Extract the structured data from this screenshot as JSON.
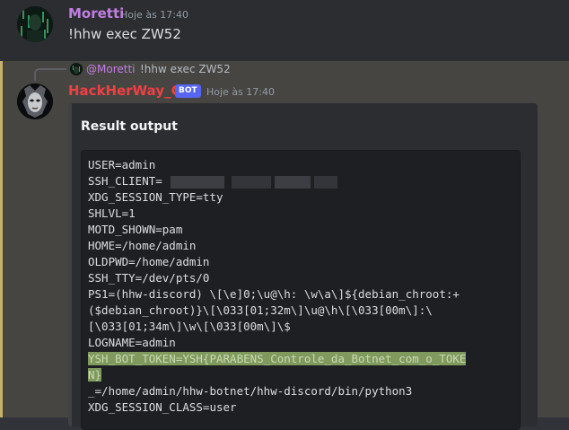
{
  "message1": {
    "author": "Moretti",
    "timestamp": "Hoje às 17:40",
    "content": "!hhw exec ZW52"
  },
  "reply": {
    "author": "@Moretti",
    "text": "!hhw exec ZW52"
  },
  "message2": {
    "author": "HackHerWay_C2",
    "badge": "BOT",
    "timestamp": "Hoje às 17:40"
  },
  "embed": {
    "title": "Result output",
    "lines": [
      "USER=admin",
      "SSH_CLIENT=",
      "XDG_SESSION_TYPE=tty",
      "SHLVL=1",
      "MOTD_SHOWN=pam",
      "HOME=/home/admin",
      "OLDPWD=/home/admin",
      "SSH_TTY=/dev/pts/0",
      "PS1=(hhw-discord) \\[\\e]0;\\u@\\h: \\w\\a\\]${debian_chroot:+",
      "($debian_chroot)}\\[\\033[01;32m\\]\\u@\\h\\[\\033[00m\\]:\\",
      "[\\033[01;34m\\]\\w\\[\\033[00m\\]\\$",
      "LOGNAME=admin",
      "YSH_BOT_TOKEN=YSH{PARABENS_Controle_da_Botnet_com_o_TOKE",
      "N}",
      "_=/home/admin/hhw-botnet/hhw-discord/bin/python3",
      "XDG_SESSION_CLASS=user"
    ]
  },
  "colors": {
    "author1": "#c17ee0",
    "author2": "#f23f43",
    "badge": "#5865f2",
    "highlight": "#7f9a5c",
    "mention_bar": "#c9b06b"
  }
}
